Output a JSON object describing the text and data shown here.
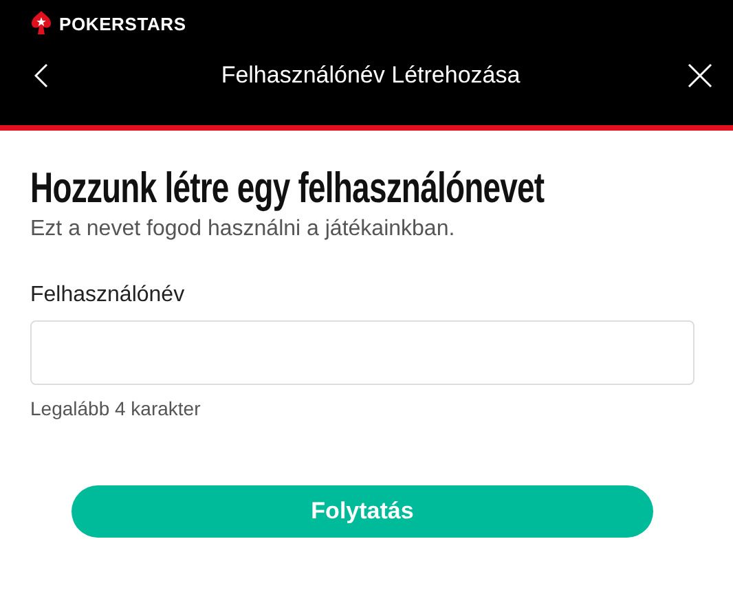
{
  "brand": {
    "name": "POKERSTARS"
  },
  "header": {
    "title": "Felhasználónév Létrehozása"
  },
  "heading": "Hozzunk létre egy felhasználónevet",
  "subtitle": "Ezt a nevet fogod használni a játékainkban.",
  "field": {
    "label": "Felhasználónév",
    "hint": "Legalább 4 karakter"
  },
  "buttons": [
    {
      "label": "Folytatás"
    }
  ]
}
